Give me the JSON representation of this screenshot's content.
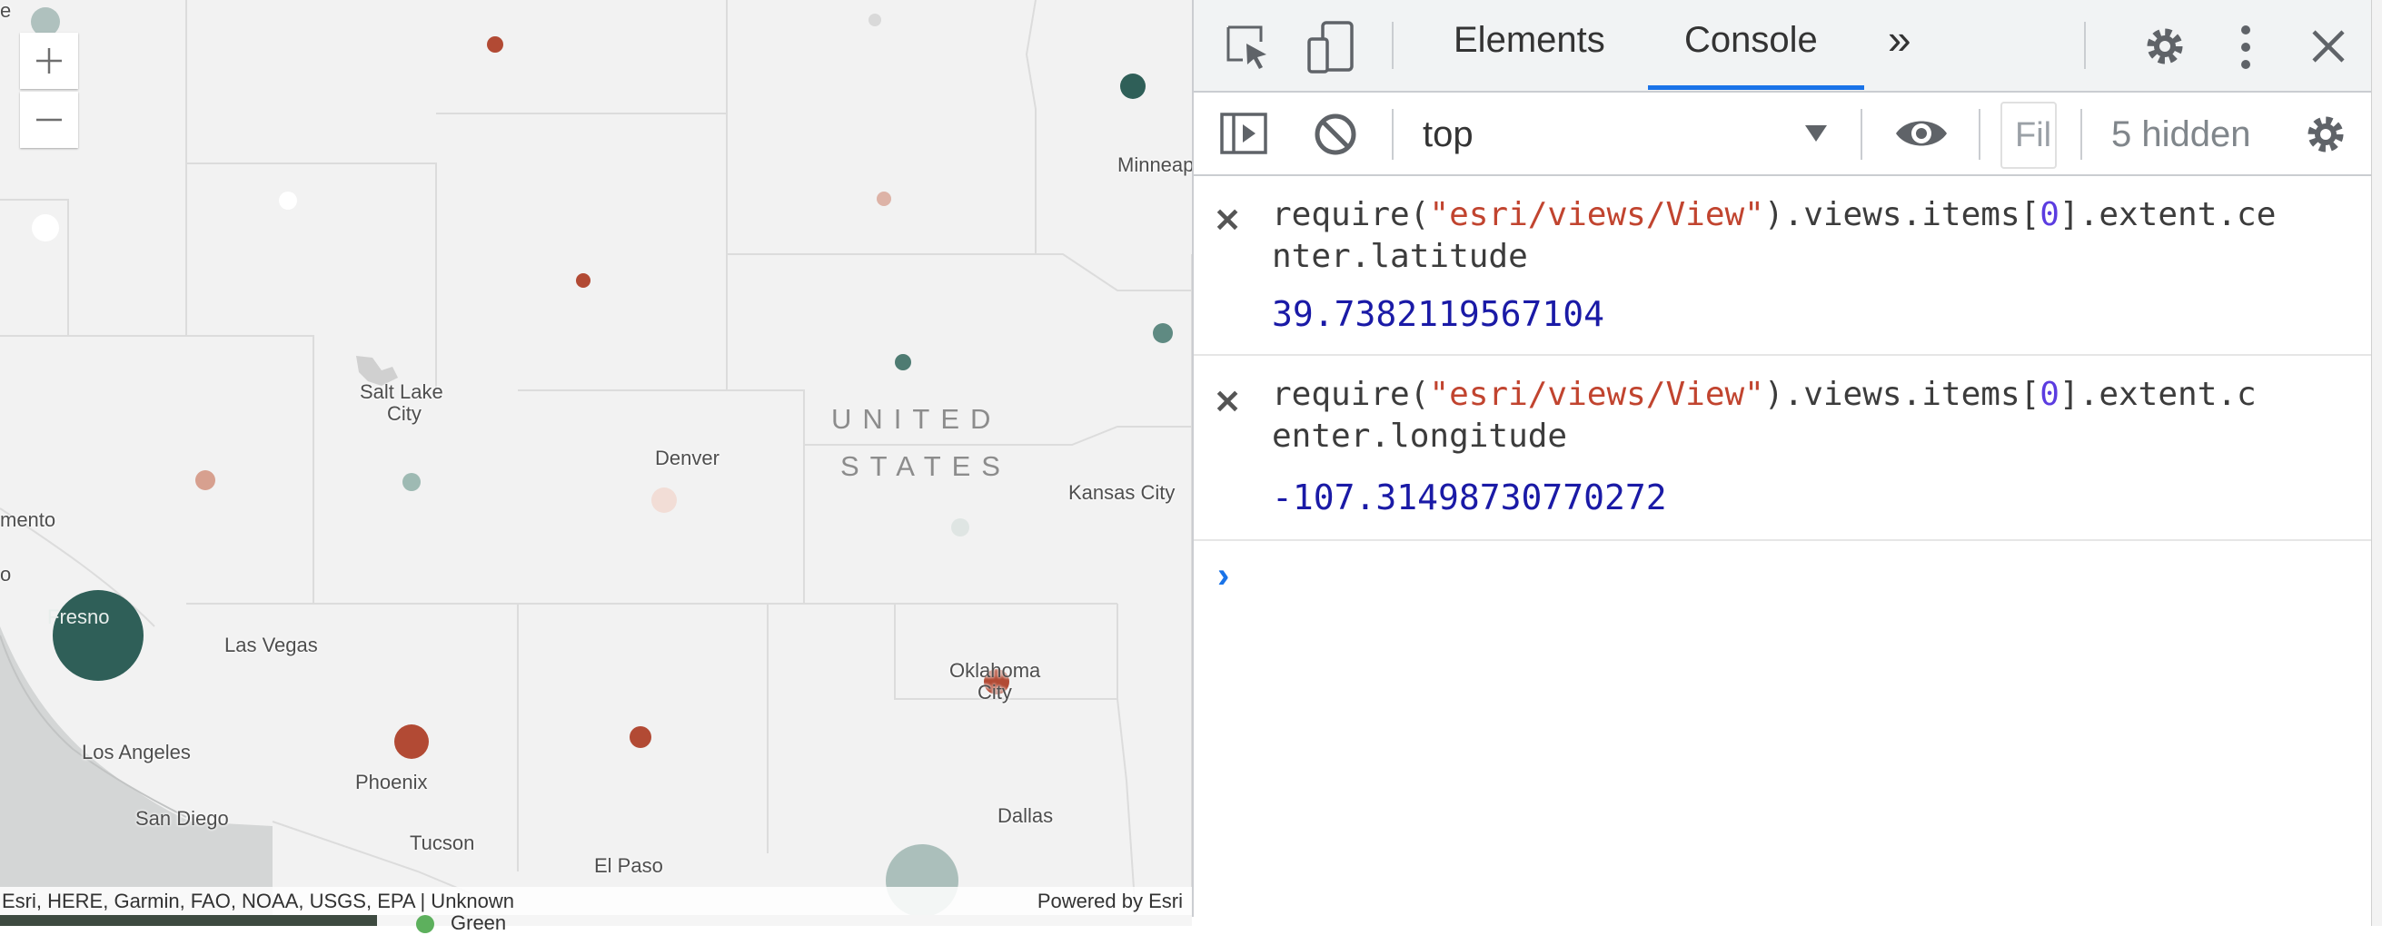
{
  "map": {
    "zoom_in_label": "Zoom in",
    "zoom_out_label": "Zoom out",
    "country_label_line1": "UNITED",
    "country_label_line2": "STATES",
    "cities": {
      "minneapolis": "Minneap",
      "salt_lake": "Salt Lake",
      "salt_lake_city": "City",
      "denver": "Denver",
      "kansas_city": "Kansas City",
      "sacramento": "mento",
      "fresno": "Fresno",
      "las_vegas": "Las Vegas",
      "oklahoma": "Oklahoma",
      "oklahoma_city": "City",
      "los_angeles": "Los Angeles",
      "phoenix": "Phoenix",
      "san_diego": "San Diego",
      "dallas": "Dallas",
      "tucson": "Tucson",
      "el_paso": "El Paso",
      "edge_o": "o",
      "edge_e": "e"
    },
    "attribution": "Esri, HERE, Garmin, FAO, NOAA, USGS, EPA | Unknown",
    "powered_by": "Powered by Esri",
    "legend_partial": "Green",
    "colors": {
      "background": "#f2f2f2",
      "boundary": "#dcdcdc",
      "water": "#d4d6d6",
      "dark_teal": "#2f5f58",
      "rust": "#b24a34"
    }
  },
  "devtools": {
    "tabs": [
      "Elements",
      "Console"
    ],
    "active_tab": "Console",
    "more_tabs": "»",
    "context": "top",
    "filter_placeholder": "Filter",
    "filter_visible": "Fil",
    "hidden_count": "5 hidden",
    "entries": [
      {
        "cmd_prefix": "require(",
        "cmd_string": "\"esri/views/View\"",
        "cmd_mid": ").views.items[",
        "cmd_index": "0",
        "cmd_suffix_line1": "].extent.ce",
        "cmd_line2": "nter.latitude",
        "result": "39.7382119567104"
      },
      {
        "cmd_prefix": "require(",
        "cmd_string": "\"esri/views/View\"",
        "cmd_mid": ").views.items[",
        "cmd_index": "0",
        "cmd_suffix_line1": "].extent.c",
        "cmd_line2": "enter.longitude",
        "result": "-107.31498730770272"
      }
    ],
    "prompt_symbol": "›",
    "icons": [
      "inspect-element-icon",
      "device-toolbar-icon",
      "settings-gear-icon",
      "more-vert-icon",
      "close-icon",
      "sidebar-toggle-icon",
      "clear-console-icon",
      "dropdown-arrow-icon",
      "live-expression-eye-icon",
      "console-settings-gear-icon"
    ]
  }
}
